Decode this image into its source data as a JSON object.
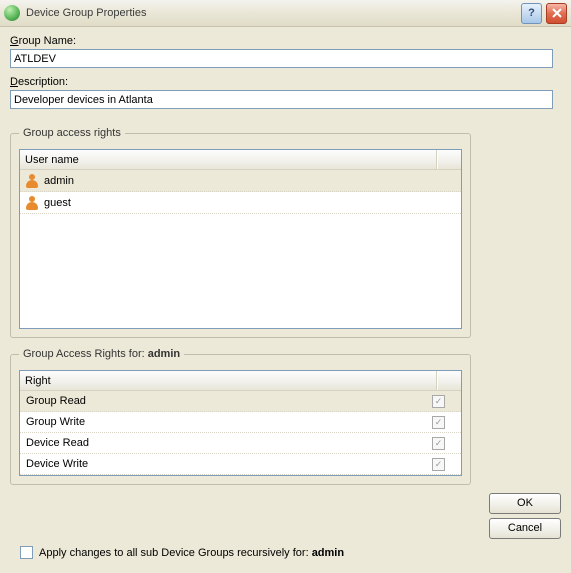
{
  "window": {
    "title": "Device Group Properties"
  },
  "fields": {
    "group_name_label": "Group Name:",
    "group_name_value": "ATLDEV",
    "description_label": "Description:",
    "description_value": "Developer devices in Atlanta"
  },
  "access_rights": {
    "legend": "Group access rights",
    "header": "User name",
    "users": [
      {
        "name": "admin",
        "selected": true
      },
      {
        "name": "guest",
        "selected": false
      }
    ]
  },
  "rights_for": {
    "legend_prefix": "Group Access Rights for: ",
    "legend_user": "admin",
    "header": "Right",
    "rows": [
      {
        "name": "Group Read",
        "checked": true,
        "selected": true
      },
      {
        "name": "Group Write",
        "checked": true,
        "selected": false
      },
      {
        "name": "Device Read",
        "checked": true,
        "selected": false
      },
      {
        "name": "Device Write",
        "checked": true,
        "selected": false
      }
    ]
  },
  "apply": {
    "label_prefix": "Apply changes to all sub Device Groups recursively for: ",
    "label_user": "admin",
    "checked": false
  },
  "buttons": {
    "ok": "OK",
    "cancel": "Cancel"
  }
}
